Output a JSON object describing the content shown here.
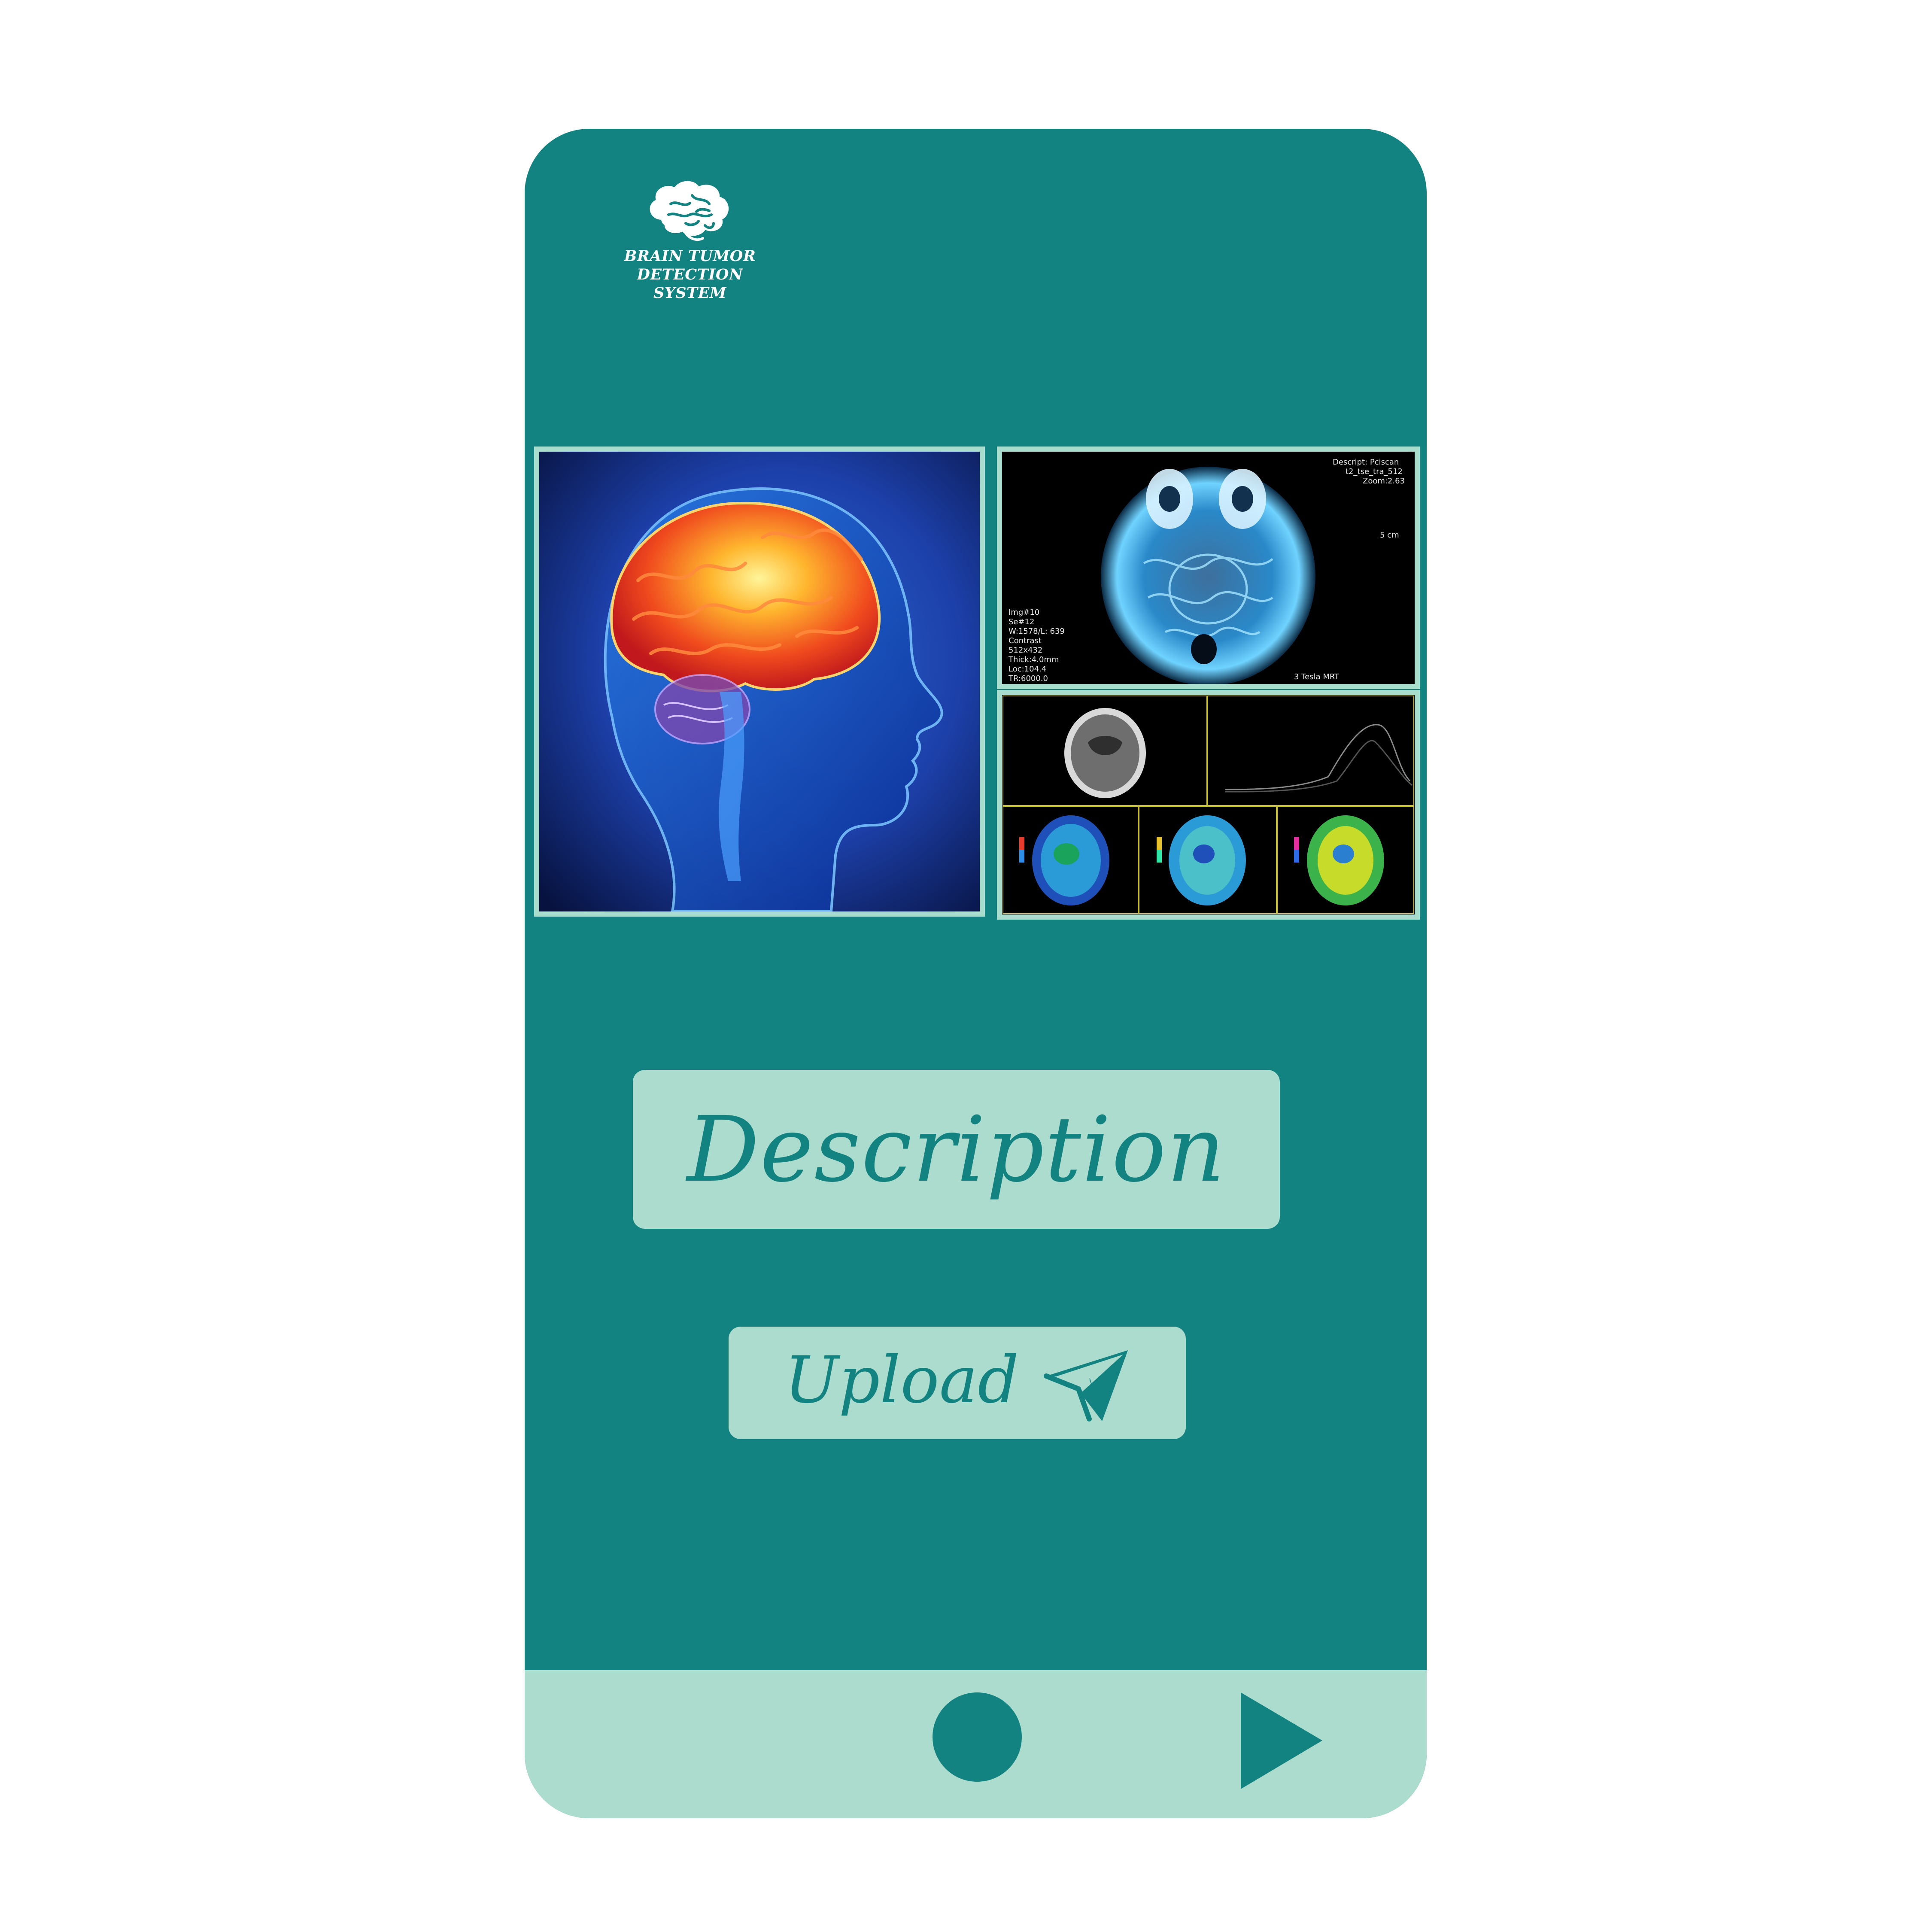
{
  "app": {
    "title": "BRAIN TUMOR DETECTION\nSYSTEM",
    "logo_icon": "brain-icon"
  },
  "images": [
    {
      "name": "brain-illustration",
      "kind": "glowing brain inside human head"
    },
    {
      "name": "mri-scan",
      "kind": "axial MRI brain scan"
    },
    {
      "name": "ct-perfusion",
      "kind": "CT perfusion panels"
    }
  ],
  "actions": {
    "description_label": "Description",
    "upload_label": "Upload",
    "upload_icon": "send-icon"
  },
  "nav": {
    "home_icon": "circle-icon",
    "play_icon": "play-icon"
  },
  "colors": {
    "primary": "#138381",
    "light": "#abdcce",
    "frame": "#a8dccc"
  }
}
